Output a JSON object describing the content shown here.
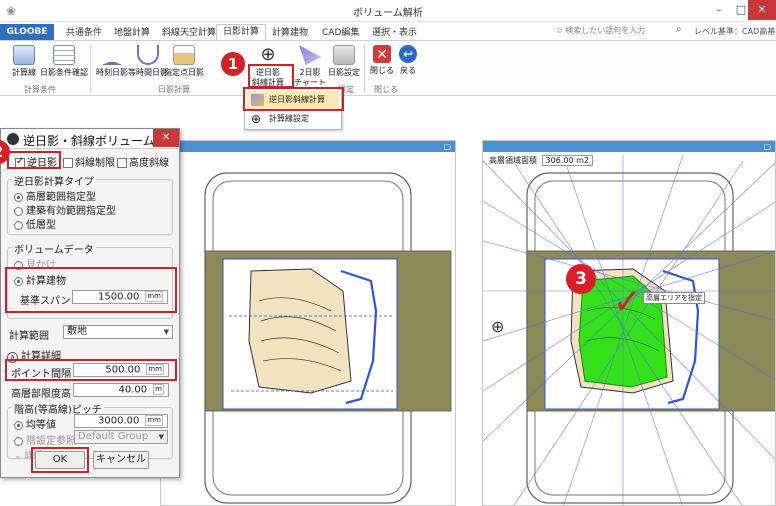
{
  "window": {
    "title": "ボリューム解析",
    "minimize": "–",
    "maximize": "□",
    "close": "✕"
  },
  "tabs": [
    "GLOOBE",
    "共通条件",
    "地盤計算",
    "斜線天空計算",
    "日影計算",
    "計算建物",
    "CAD編集",
    "選択・表示"
  ],
  "search_placeholder": "検索したい語句を入力",
  "level_label": "レベル基準：CAD高基準",
  "ribbon": {
    "buttons": [
      "計算線",
      "日影条件確認",
      "時刻日影",
      "等時間日影",
      "指定点日影",
      "逆日影\n斜線計算",
      "2日影\nチャート",
      "日影設定",
      "閉じる",
      "戻る"
    ],
    "group_labels": [
      "計算条件",
      "日影計算",
      "設定",
      "閉じる"
    ]
  },
  "dropdown": {
    "items": [
      "逆日影斜線計算",
      "計算線設定"
    ]
  },
  "badges": [
    "1",
    "2",
    "3"
  ],
  "dialog": {
    "title": "逆日影・斜線ボリューム計算",
    "close": "✕",
    "checks": [
      "逆日影",
      "斜線制限",
      "高度斜線"
    ],
    "calc_type_title": "逆日影計算タイプ",
    "calc_type_options": [
      "高層範囲指定型",
      "建築有効範囲指定型",
      "低層型"
    ],
    "volume_title": "ボリュームデータ",
    "volume_options": [
      "見かけ",
      "計算建物"
    ],
    "span_label": "基準スパン",
    "span_value": "1500.00",
    "span_unit": "mm",
    "range_label": "計算範囲",
    "range_value": "敷地",
    "detail_label": "計算詳細",
    "point_label": "ポイント間隔",
    "point_value": "500.00",
    "point_unit": "mm",
    "limit_label": "高層部限度高",
    "limit_value": "40.00",
    "limit_unit": "m",
    "pitch_title": "階高(等高線)ピッチ",
    "pitch_options": [
      "均等値",
      "階設定参照"
    ],
    "pitch_value": "3000.00",
    "pitch_unit": "mm",
    "group_value": "Default Group",
    "more_label": "詳細",
    "ok": "OK",
    "cancel": "キャンセル"
  },
  "right_panel": {
    "area_label": "高層領域面積",
    "area_value": "306.00",
    "area_unit": "m2",
    "callout": "高層エリアを指定"
  },
  "colors": {
    "accent_red": "#d61f27",
    "panel_header": "#4d8fd6",
    "terrain_olive": "#8c8a59",
    "highlight_green": "#33e01a",
    "wire_blue": "#2f56d8"
  }
}
